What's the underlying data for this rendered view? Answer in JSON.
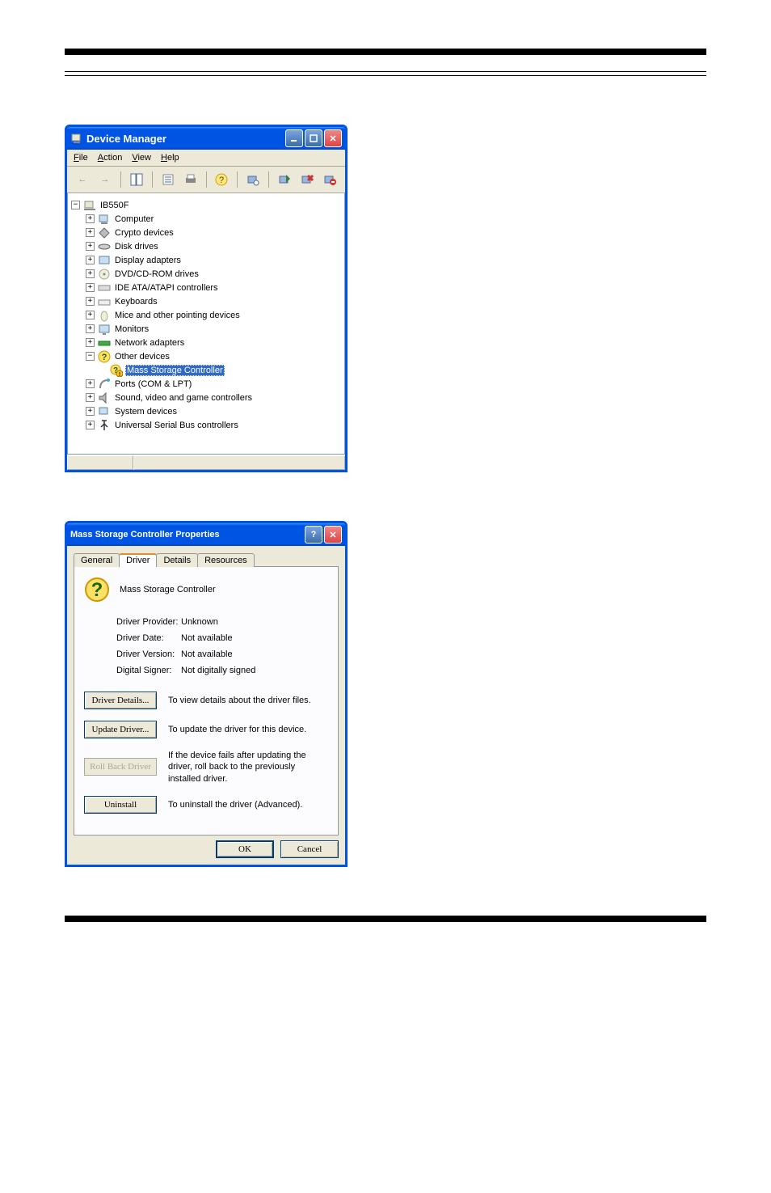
{
  "deviceManager": {
    "title": "Device Manager",
    "menu": {
      "file": "File",
      "action": "Action",
      "view": "View",
      "help": "Help"
    },
    "root": "IB550F",
    "nodes": [
      {
        "label": "Computer",
        "icon": "computer"
      },
      {
        "label": "Crypto devices",
        "icon": "crypto"
      },
      {
        "label": "Disk drives",
        "icon": "disk"
      },
      {
        "label": "Display adapters",
        "icon": "display"
      },
      {
        "label": "DVD/CD-ROM drives",
        "icon": "dvd"
      },
      {
        "label": "IDE ATA/ATAPI controllers",
        "icon": "ide"
      },
      {
        "label": "Keyboards",
        "icon": "keyboard"
      },
      {
        "label": "Mice and other pointing devices",
        "icon": "mouse"
      },
      {
        "label": "Monitors",
        "icon": "monitor"
      },
      {
        "label": "Network adapters",
        "icon": "network"
      }
    ],
    "otherDevices": {
      "label": "Other devices",
      "child": "Mass Storage Controller"
    },
    "nodes2": [
      {
        "label": "Ports (COM & LPT)",
        "icon": "port"
      },
      {
        "label": "Sound, video and game controllers",
        "icon": "sound"
      },
      {
        "label": "System devices",
        "icon": "system"
      },
      {
        "label": "Universal Serial Bus controllers",
        "icon": "usb"
      }
    ]
  },
  "props": {
    "title": "Mass Storage Controller Properties",
    "tabs": {
      "general": "General",
      "driver": "Driver",
      "details": "Details",
      "resources": "Resources"
    },
    "deviceName": "Mass Storage Controller",
    "info": {
      "providerLabel": "Driver Provider:",
      "providerValue": "Unknown",
      "dateLabel": "Driver Date:",
      "dateValue": "Not available",
      "versionLabel": "Driver Version:",
      "versionValue": "Not available",
      "signerLabel": "Digital Signer:",
      "signerValue": "Not digitally signed"
    },
    "buttons": {
      "details": "Driver Details...",
      "detailsDesc": "To view details about the driver files.",
      "update": "Update Driver...",
      "updateDesc": "To update the driver for this device.",
      "rollback": "Roll Back Driver",
      "rollbackDesc": "If the device fails after updating the driver, roll back to the previously installed driver.",
      "uninstall": "Uninstall",
      "uninstallDesc": "To uninstall the driver (Advanced).",
      "ok": "OK",
      "cancel": "Cancel"
    }
  }
}
